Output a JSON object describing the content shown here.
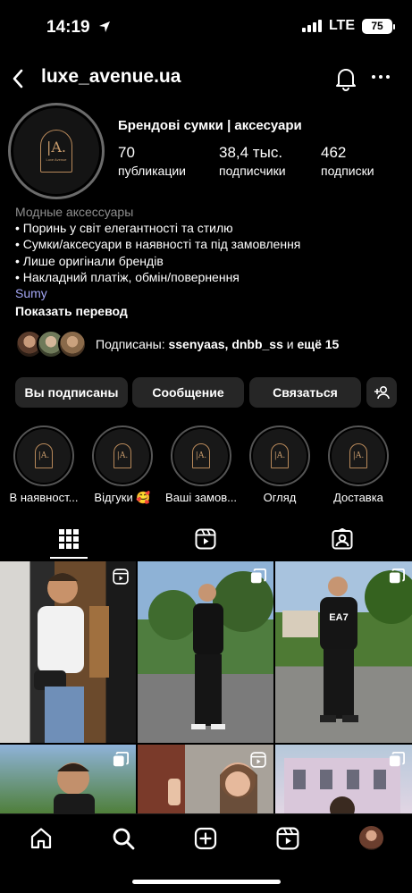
{
  "status": {
    "time": "14:19",
    "network": "LTE",
    "battery": "75"
  },
  "header": {
    "username": "luxe_avenue.ua"
  },
  "profile": {
    "category_title": "Брендові сумки | аксесуари",
    "stats": [
      {
        "value": "70",
        "label": "публикации"
      },
      {
        "value": "38,4 тыс.",
        "label": "подписчики"
      },
      {
        "value": "462",
        "label": "подписки"
      }
    ],
    "avatar_caption": "Luxe Avenue",
    "bio": {
      "category": "Модные аксессуары",
      "lines": [
        "• Поринь у світ елегантності та стилю",
        "• Сумки/аксесуари в наявності та під замовлення",
        "• Лише оригінали брендів",
        "• Накладний платіж, обмін/повернення"
      ],
      "location": "Sumy",
      "translate": "Показать перевод"
    },
    "followed_by": {
      "prefix": "Подписаны: ",
      "names": "ssenyaas, dnbb_ss",
      "middle": " и ",
      "more": "ещё 15"
    }
  },
  "buttons": {
    "following": "Вы подписаны",
    "message": "Сообщение",
    "contact": "Связаться"
  },
  "highlights": [
    {
      "label": "В наявност..."
    },
    {
      "label": "Відгуки 🥰"
    },
    {
      "label": "Ваші замов..."
    },
    {
      "label": "Огляд"
    },
    {
      "label": "Доставка"
    }
  ],
  "post_overlay_texts": {
    "ea7": "EA7"
  },
  "colors": {
    "background": "#000000",
    "button": "#262626",
    "link": "#a4a7f5",
    "muted": "#8e8e8e",
    "gold": "#c69a6b"
  },
  "icons": [
    "location-arrow-icon",
    "back-chevron-icon",
    "bell-icon",
    "more-icon",
    "add-person-icon",
    "grid-icon",
    "reels-icon",
    "tagged-icon",
    "home-icon",
    "search-icon",
    "create-icon",
    "reels-nav-icon",
    "profile-avatar-icon"
  ]
}
